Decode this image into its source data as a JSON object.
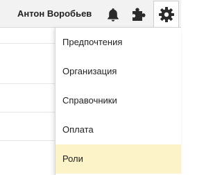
{
  "header": {
    "user_name": "Антон Воробьев",
    "icons": [
      "bell-icon",
      "puzzle-icon",
      "gear-icon"
    ]
  },
  "settings_menu": {
    "items": [
      {
        "label": "Предпочтения"
      },
      {
        "label": "Организация"
      },
      {
        "label": "Справочники"
      },
      {
        "label": "Оплата"
      },
      {
        "label": "Роли",
        "highlighted": true
      }
    ]
  },
  "colors": {
    "header_bg": "#f2f2f2",
    "icon": "#2b2b2b",
    "highlight": "#fcf3c8",
    "text": "#222222"
  }
}
